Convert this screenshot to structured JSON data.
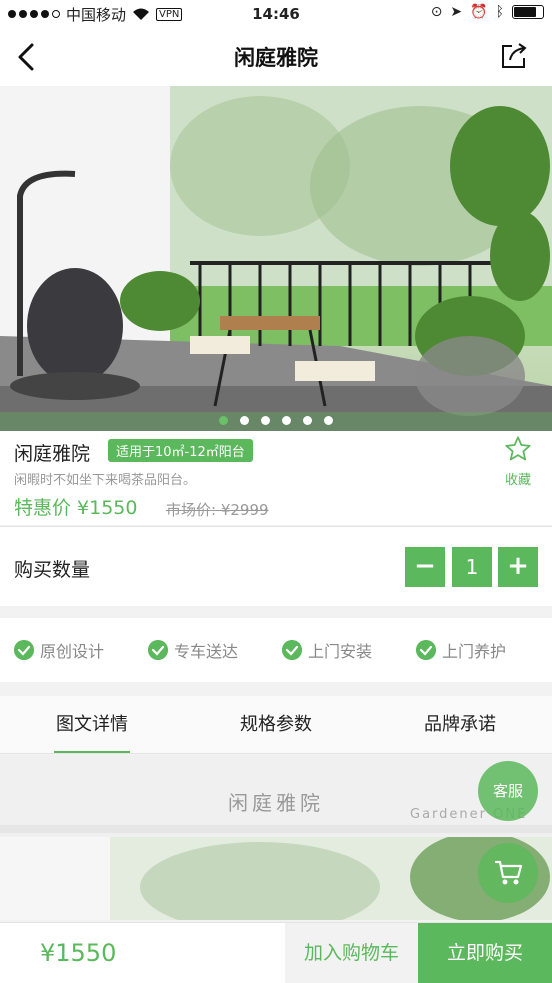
{
  "status_bar": {
    "carrier": "中国移动",
    "vpn": "VPN",
    "time": "14:46"
  },
  "nav": {
    "title": "闲庭雅院",
    "back_icon": "chevron-left-icon",
    "share_icon": "share-icon"
  },
  "gallery": {
    "page_count": 6,
    "active_index": 0
  },
  "product": {
    "name": "闲庭雅院",
    "tag": "适用于10㎡-12㎡阳台",
    "subtitle": "闲暇时不如坐下来喝茶品阳台。",
    "price_label": "特惠价 ¥1550",
    "market_price": "市场价: ¥2999",
    "favorite_label": "收藏"
  },
  "quantity": {
    "label": "购买数量",
    "minus": "−",
    "value": "1",
    "plus": "+"
  },
  "features": [
    "原创设计",
    "专车送达",
    "上门安装",
    "上门养护"
  ],
  "tabs": [
    {
      "label": "图文详情",
      "active": true
    },
    {
      "label": "规格参数",
      "active": false
    },
    {
      "label": "品牌承诺",
      "active": false
    }
  ],
  "detail": {
    "title": "闲庭雅院",
    "brand": "Gardener ONE"
  },
  "floating": {
    "service_label": "客服",
    "cart_icon": "cart-icon"
  },
  "bottom": {
    "total": "¥1550",
    "add_to_cart": "加入购物车",
    "buy_now": "立即购买"
  },
  "colors": {
    "accent": "#5cb85c",
    "muted_text": "#999999"
  }
}
